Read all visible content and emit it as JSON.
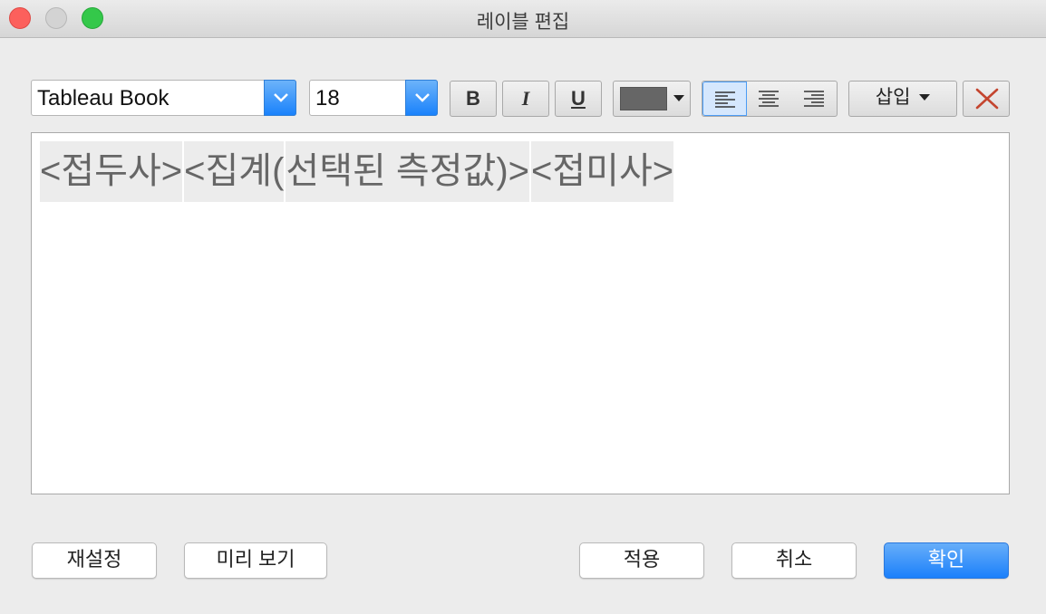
{
  "window": {
    "title": "레이블 편집"
  },
  "toolbar": {
    "font": {
      "value": "Tableau Book"
    },
    "size": {
      "value": "18"
    },
    "bold_label": "B",
    "italic_label": "I",
    "underline_label": "U",
    "text_color": "#666666",
    "align_active": "left",
    "insert_label": "삽입",
    "clear_color": "#c4452f"
  },
  "editor": {
    "tokens": [
      "<접두사>",
      "<집계(",
      "선택된 측정값)>",
      "<접미사>"
    ]
  },
  "buttons": {
    "reset": "재설정",
    "preview": "미리 보기",
    "apply": "적용",
    "cancel": "취소",
    "ok": "확인"
  }
}
